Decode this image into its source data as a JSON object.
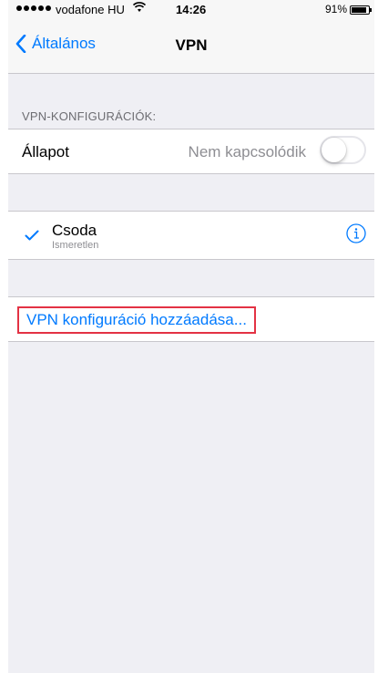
{
  "status_bar": {
    "carrier": "vodafone HU",
    "time": "14:26",
    "battery": "91%",
    "battery_level": 0.91
  },
  "nav": {
    "back_label": "Általános",
    "title": "VPN"
  },
  "section": {
    "header": "VPN-KONFIGURÁCIÓK:"
  },
  "status_row": {
    "label": "Állapot",
    "value": "Nem kapcsolódik",
    "toggle_on": false
  },
  "vpn_config": {
    "name": "Csoda",
    "subtitle": "Ismeretlen",
    "selected": true
  },
  "add_config": {
    "label": "VPN konfiguráció hozzáadása..."
  },
  "colors": {
    "accent": "#007aff",
    "highlight_border": "#e33244",
    "background": "#efeff4"
  },
  "icons": [
    "signal-dots-icon",
    "wifi-icon",
    "battery-icon",
    "chevron-left-icon",
    "checkmark-icon",
    "info-icon"
  ]
}
